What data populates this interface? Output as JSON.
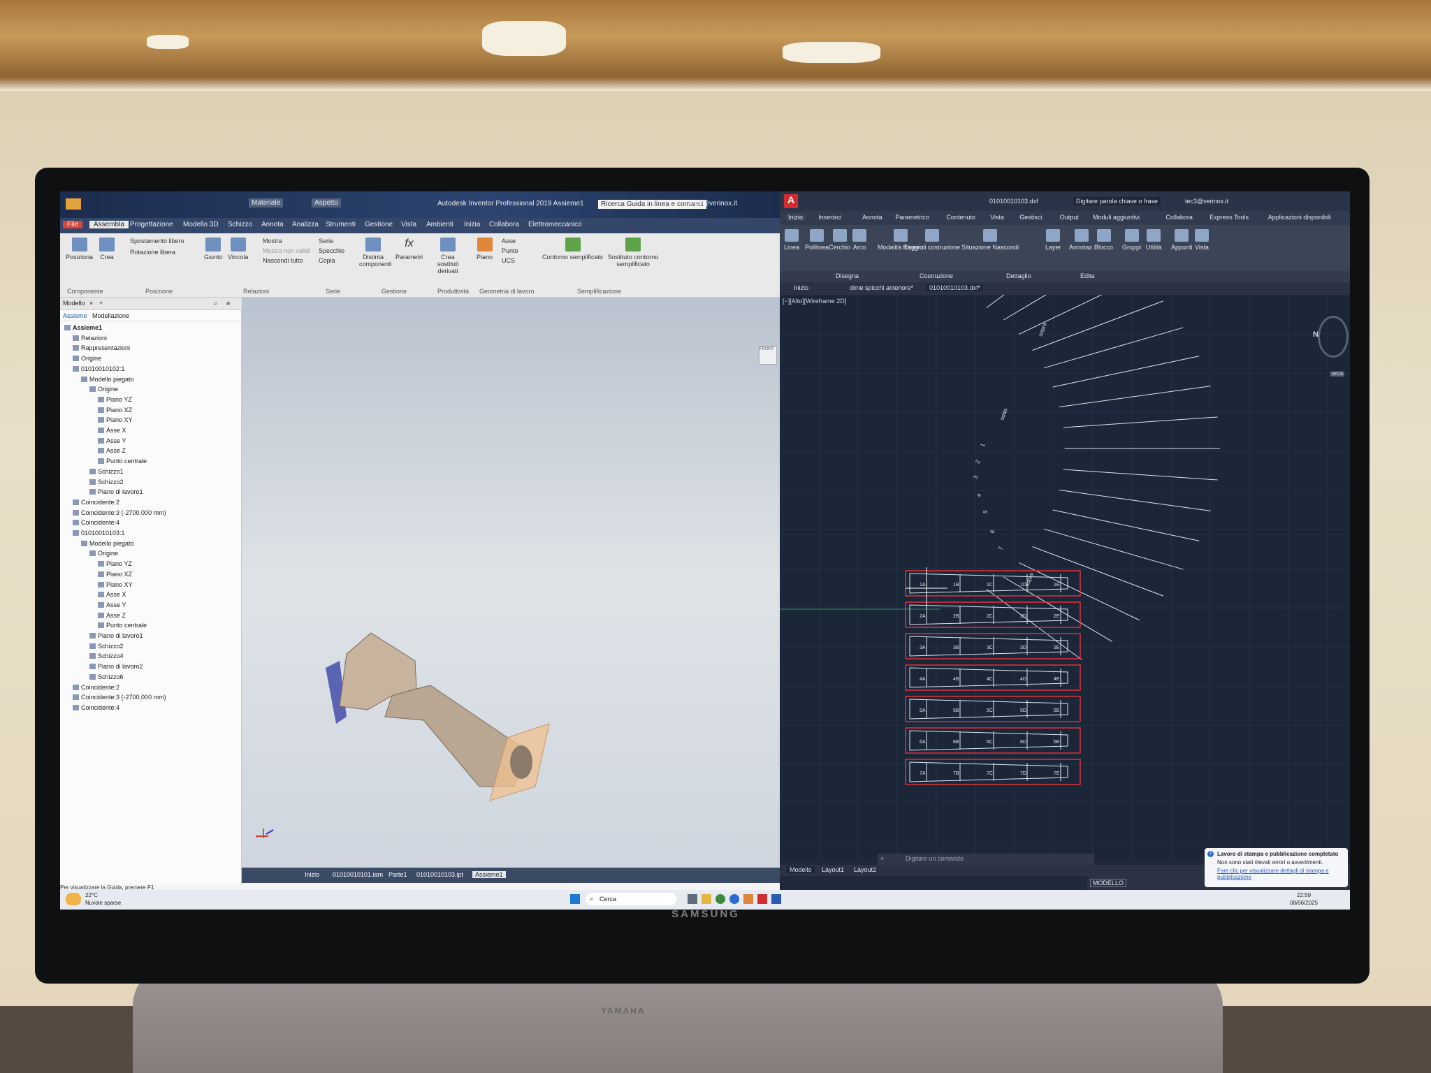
{
  "monitor": {
    "brand": "SAMSUNG"
  },
  "soundbar": {
    "brand": "YAMAHA"
  },
  "inventor": {
    "window_title": "Autodesk Inventor Professional 2019   Assieme1",
    "help_search": "Ricerca Guida in linea e comandi",
    "user": "tec3@verinox.it",
    "qat_style": "Materiale",
    "qat_appearance": "Aspetto",
    "tabs": [
      "File",
      "Assembla",
      "Progettazione",
      "Modello 3D",
      "Schizzo",
      "Annota",
      "Analizza",
      "Strumenti",
      "Gestione",
      "Vista",
      "Ambienti",
      "Inizia",
      "Collabora",
      "Elettromeccanico"
    ],
    "ribbon": {
      "posiziona": "Posiziona",
      "crea": "Crea",
      "componente_group": "Componente",
      "spostamento_libero": "Spostamento libero",
      "rotazione_libera": "Rotazione libera",
      "posizione_group": "Posizione",
      "giunto": "Giunto",
      "vincola": "Vincola",
      "mostra": "Mostra",
      "mostra_non_validi": "Mostra non validi",
      "nascondi_tutto": "Nascondi tutto",
      "relazioni_group": "Relazioni",
      "serie": "Serie",
      "specchio": "Specchio",
      "copia": "Copia",
      "serie_group": "Serie",
      "distinta": "Distinta componenti",
      "parametri": "Parametri",
      "gestione_group": "Gestione",
      "crea_sostituti": "Crea sostituti derivati",
      "produttivita_group": "Produttività",
      "piano": "Piano",
      "asse": "Asse",
      "punto": "Punto",
      "ucs": "UCS",
      "geometria_group": "Geometria di lavoro",
      "contorno": "Contorno semplificato",
      "sostituto": "Sostituto contorno semplificato",
      "semplificazione_group": "Semplificazione"
    },
    "browser": {
      "tabs": [
        "Modello"
      ],
      "subtabs": [
        "Assieme",
        "Modellazione"
      ],
      "tree": [
        {
          "label": "Assieme1",
          "level": 0
        },
        {
          "label": "Relazioni",
          "level": 1
        },
        {
          "label": "Rappresentazioni",
          "level": 1
        },
        {
          "label": "Origine",
          "level": 1
        },
        {
          "label": "01010010102:1",
          "level": 1
        },
        {
          "label": "Modello piegato",
          "level": 2
        },
        {
          "label": "Origine",
          "level": 3
        },
        {
          "label": "Piano YZ",
          "level": 4
        },
        {
          "label": "Piano XZ",
          "level": 4
        },
        {
          "label": "Piano XY",
          "level": 4
        },
        {
          "label": "Asse X",
          "level": 4
        },
        {
          "label": "Asse Y",
          "level": 4
        },
        {
          "label": "Asse Z",
          "level": 4
        },
        {
          "label": "Punto centrale",
          "level": 4
        },
        {
          "label": "Schizzo1",
          "level": 3
        },
        {
          "label": "Schizzo2",
          "level": 3
        },
        {
          "label": "Piano di lavoro1",
          "level": 3
        },
        {
          "label": "Coincidente:2",
          "level": 1
        },
        {
          "label": "Coincidente:3 (-2700,000 mm)",
          "level": 1
        },
        {
          "label": "Coincidente:4",
          "level": 1
        },
        {
          "label": "01010010103:1",
          "level": 1
        },
        {
          "label": "Modello piegato",
          "level": 2
        },
        {
          "label": "Origine",
          "level": 3
        },
        {
          "label": "Piano YZ",
          "level": 4
        },
        {
          "label": "Piano XZ",
          "level": 4
        },
        {
          "label": "Piano XY",
          "level": 4
        },
        {
          "label": "Asse X",
          "level": 4
        },
        {
          "label": "Asse Y",
          "level": 4
        },
        {
          "label": "Asse Z",
          "level": 4
        },
        {
          "label": "Punto centrale",
          "level": 4
        },
        {
          "label": "Piano di lavoro1",
          "level": 3
        },
        {
          "label": "Schizzo2",
          "level": 3
        },
        {
          "label": "Schizzo4",
          "level": 3
        },
        {
          "label": "Piano di lavoro2",
          "level": 3
        },
        {
          "label": "Schizzo6",
          "level": 3
        },
        {
          "label": "Coincidente:2",
          "level": 1
        },
        {
          "label": "Coincidente:3 (-2700,000 mm)",
          "level": 1
        },
        {
          "label": "Coincidente:4",
          "level": 1
        }
      ]
    },
    "doc_tabs": [
      "Inizio",
      "01010010101.iam",
      "Parte1",
      "01010010103.ipt",
      "Assieme1"
    ],
    "status_hint": "Per visualizzare la Guida, premere F1",
    "viewcube_label": "FRONT"
  },
  "autocad": {
    "file_name": "01010010103.dxf",
    "search": "Digitare parola chiave o frase",
    "user": "tec3@verinox.it",
    "tabs": [
      "Inizio",
      "Inserisci",
      "Annota",
      "Parametrico",
      "Contenuto",
      "Vista",
      "Gestisci",
      "Output",
      "Moduli aggiuntivi",
      "Collabora",
      "Express Tools",
      "Applicazioni disponibili"
    ],
    "ribbon": [
      "Linea",
      "Polilinea",
      "Cerchio",
      "Arco",
      "Modalità Raggio",
      "Linee di costruzione",
      "Situazione Nascondi",
      "Layer",
      "Annotaz.",
      "Blocco",
      "Gruppi",
      "Utilità",
      "Appunti",
      "Vista"
    ],
    "groups": [
      "Disegna",
      "Costruzione",
      "Dettaglio",
      "Edita"
    ],
    "doc_tabs": [
      "Inizio",
      "dime spicchi anteriore*",
      "01010010103.dxf*"
    ],
    "view_label": "[−][Alto][Wireframe 2D]",
    "compass": "N",
    "wcs": "WCS",
    "fan_labels": [
      "sopra",
      "sotto",
      "1",
      "2",
      "3",
      "4",
      "5",
      "6",
      "7",
      "sopra"
    ],
    "strip_labels": [
      [
        "1A",
        "1B",
        "1C",
        "1D",
        "1E"
      ],
      [
        "2A",
        "2B",
        "2C",
        "2D",
        "2E"
      ],
      [
        "3A",
        "3B",
        "3C",
        "3D",
        "3E"
      ],
      [
        "4A",
        "4B",
        "4C",
        "4D",
        "4E"
      ],
      [
        "5A",
        "5B",
        "5C",
        "5D",
        "5E"
      ],
      [
        "6A",
        "6B",
        "6C",
        "6D",
        "6E"
      ],
      [
        "7A",
        "7B",
        "7C",
        "7D",
        "7E"
      ]
    ],
    "command_placeholder": "Digitare un comando",
    "layouts": [
      "Modello",
      "Layout1",
      "Layout2"
    ],
    "status_mode": "MODELLO",
    "toast": {
      "title": "Lavoro di stampa e pubblicazione completato",
      "body": "Non sono stati rilevati errori o avvertimenti.",
      "link": "Fare clic per visualizzare dettagli di stampa e pubblicazione"
    }
  },
  "taskbar": {
    "search": "Cerca",
    "weather_temp": "22°C",
    "weather_desc": "Nuvole sparse",
    "time": "22:59",
    "date": "08/06/2025"
  },
  "colors": {
    "inventor_blue": "#2d4470",
    "acad_bg": "#1b2738",
    "cad_line": "#dde4ee",
    "highlight_red": "#e0303a"
  }
}
